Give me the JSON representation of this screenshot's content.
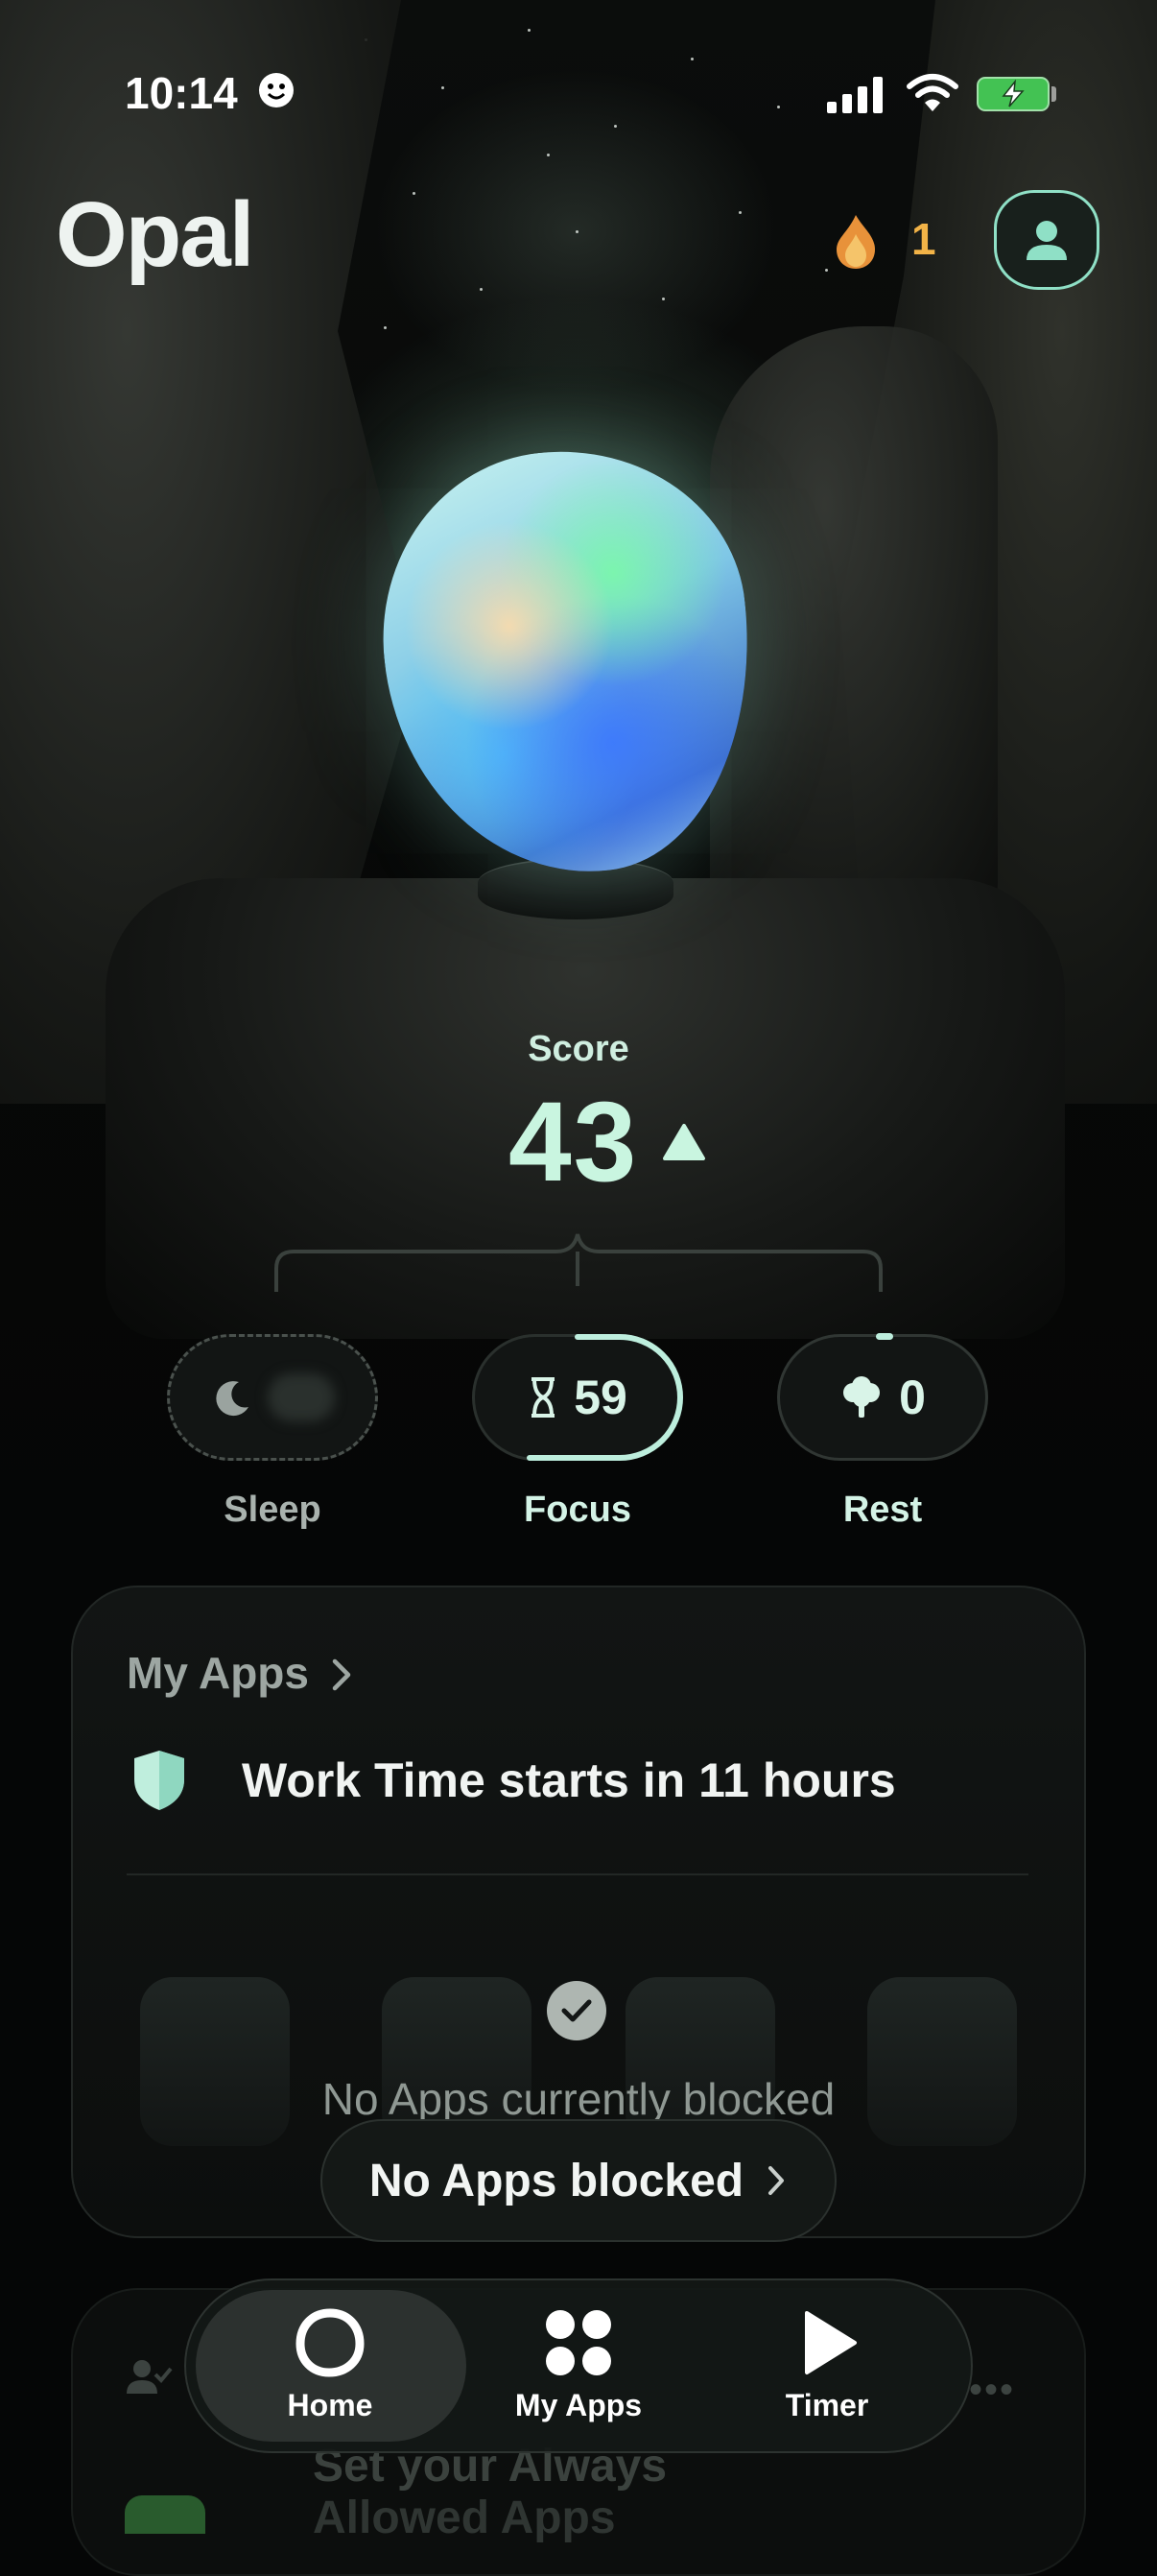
{
  "status_bar": {
    "time": "10:14"
  },
  "header": {
    "logo": "Opal",
    "streak_count": "1"
  },
  "score": {
    "label": "Score",
    "value": "43"
  },
  "metrics": [
    {
      "label": "Sleep",
      "value": "",
      "icon": "moon-icon"
    },
    {
      "label": "Focus",
      "value": "59",
      "icon": "hourglass-icon"
    },
    {
      "label": "Rest",
      "value": "0",
      "icon": "tree-icon"
    }
  ],
  "my_apps_card": {
    "title": "My Apps",
    "schedule_text": "Work Time starts in 11 hours",
    "empty_text": "No Apps currently blocked",
    "button_label": "No Apps blocked"
  },
  "next_card": {
    "text_line1": "Set your Always",
    "text_line2": "Allowed Apps"
  },
  "tabbar": {
    "tabs": [
      {
        "label": "Home",
        "icon": "opal-ring-icon",
        "active": true
      },
      {
        "label": "My Apps",
        "icon": "grid-dots-icon",
        "active": false
      },
      {
        "label": "Timer",
        "icon": "play-icon",
        "active": false
      }
    ]
  },
  "colors": {
    "accent": "#c9f5e0",
    "streak": "#f2b347",
    "battery": "#43c253",
    "profile_border": "#8fe0c6"
  }
}
